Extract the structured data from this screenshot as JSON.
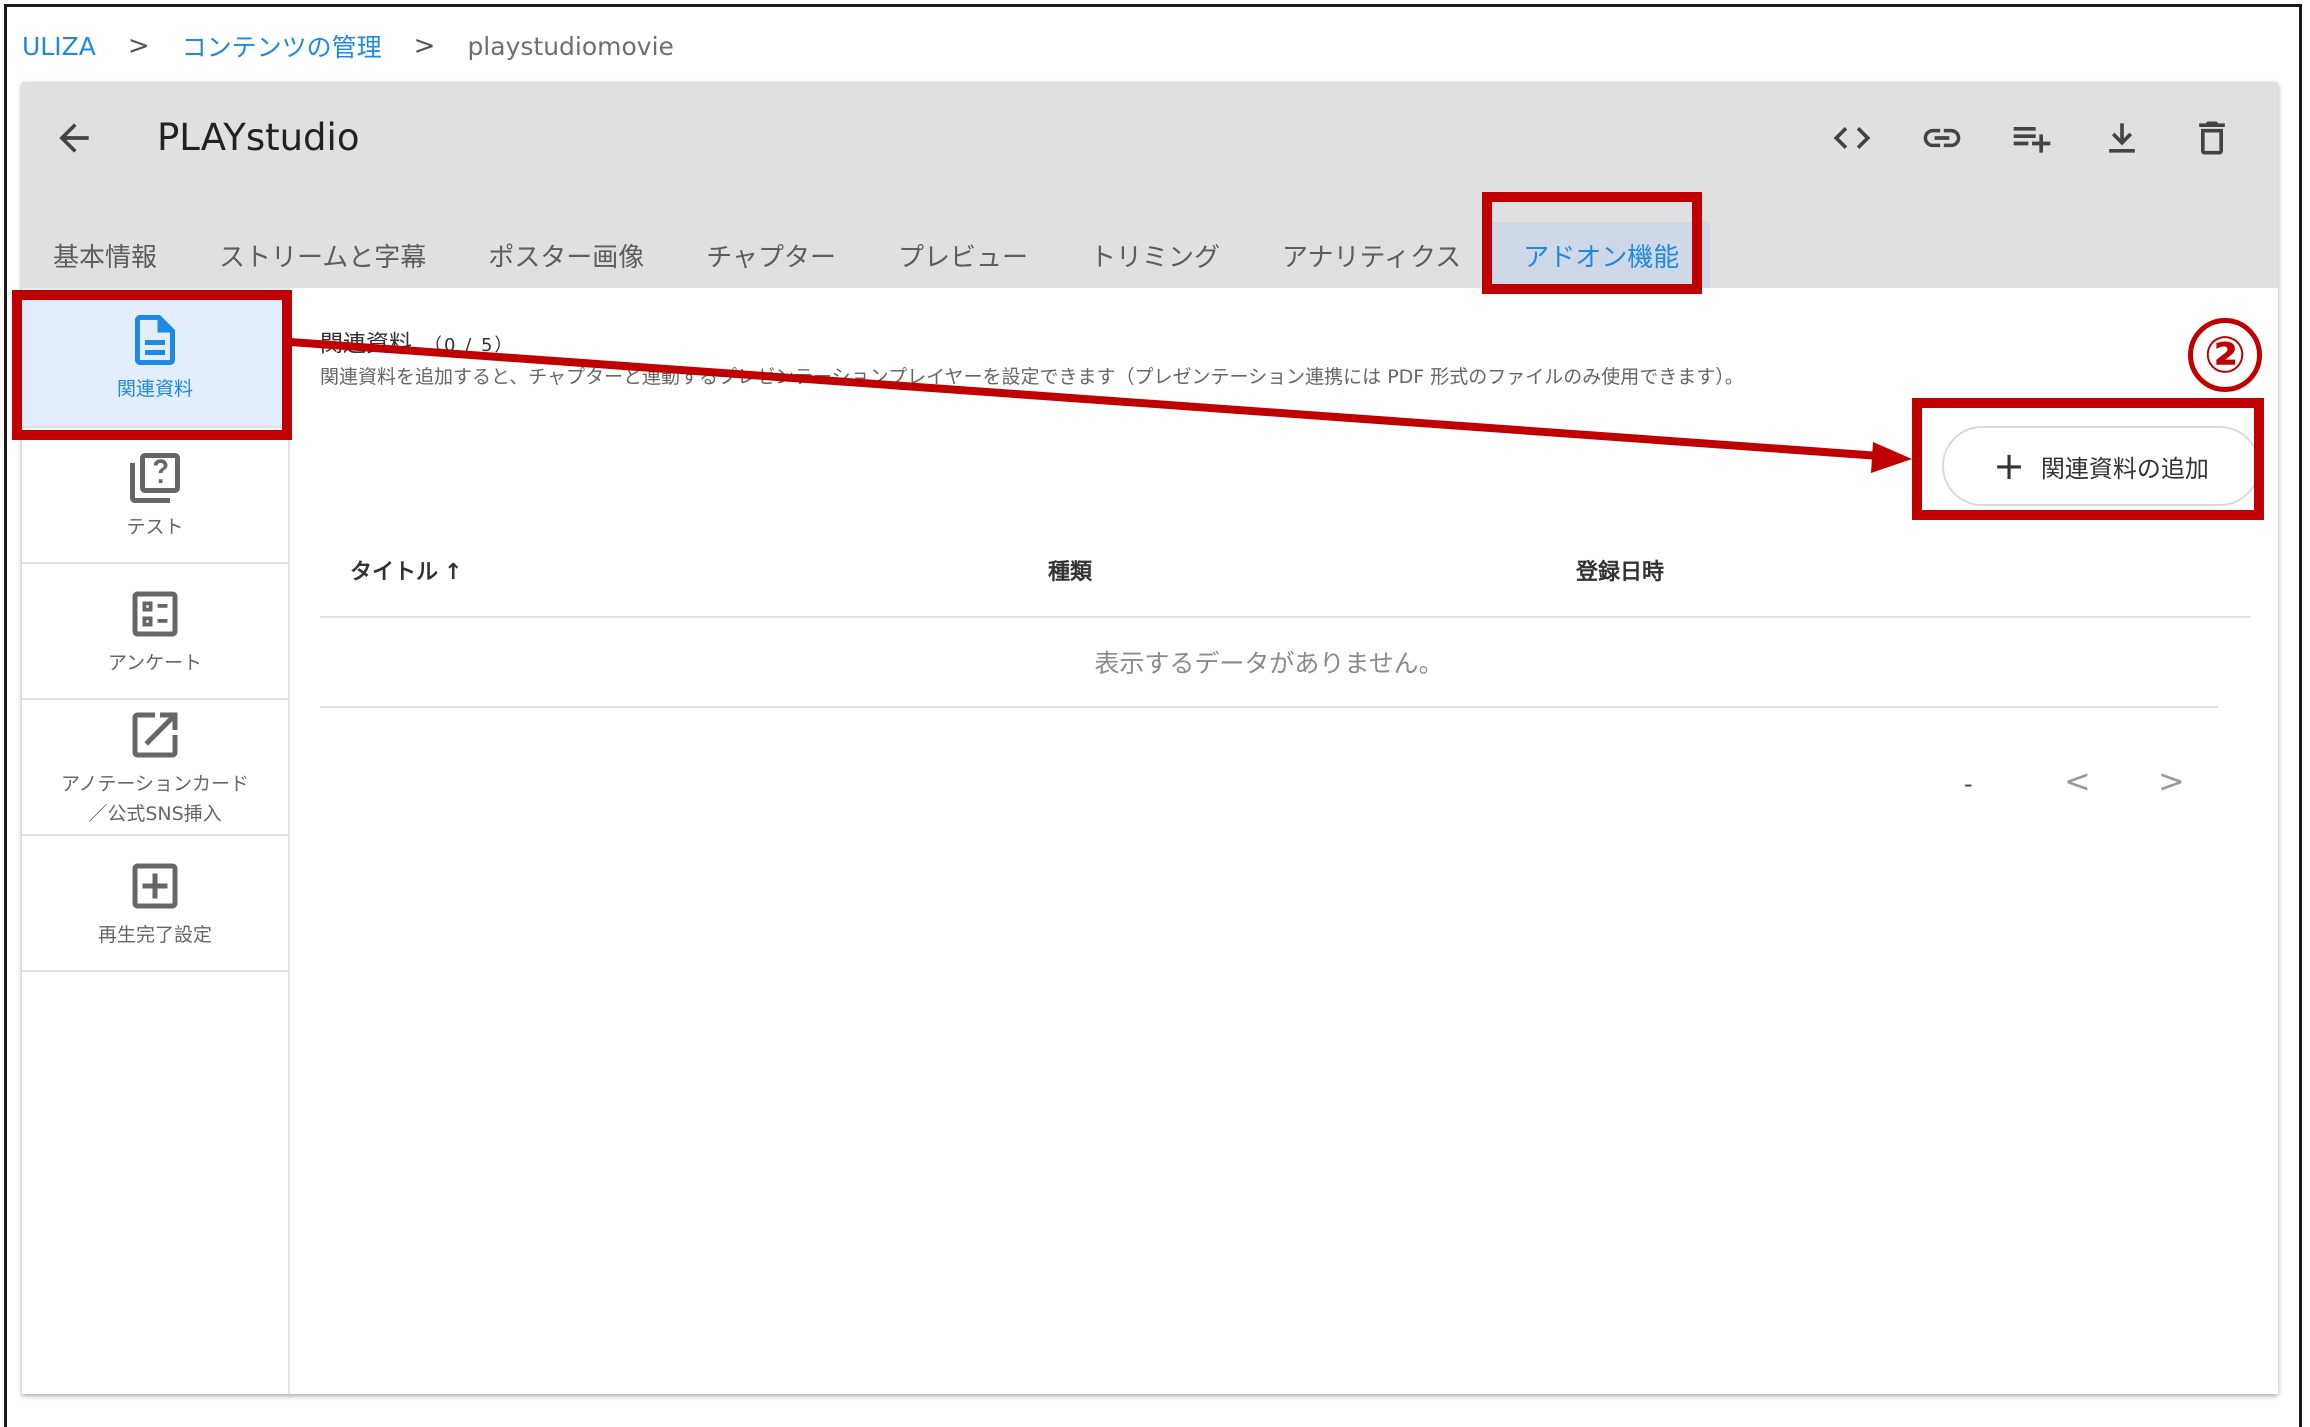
{
  "breadcrumb": {
    "items": [
      "ULIZA",
      "コンテンツの管理"
    ],
    "separator": ">",
    "current": "playstudiomovie"
  },
  "header": {
    "title": "PLAYstudio",
    "back_icon": "arrow-left-icon",
    "toolbar_icons": [
      "code-icon",
      "link-icon",
      "playlist-add-icon",
      "download-icon",
      "delete-icon"
    ]
  },
  "tabs": [
    {
      "label": "基本情報"
    },
    {
      "label": "ストリームと字幕"
    },
    {
      "label": "ポスター画像"
    },
    {
      "label": "チャプター"
    },
    {
      "label": "プレビュー"
    },
    {
      "label": "トリミング"
    },
    {
      "label": "アナリティクス"
    },
    {
      "label": "アドオン機能",
      "active": true
    }
  ],
  "sidebar": {
    "items": [
      {
        "label": "関連資料",
        "icon": "document-icon",
        "active": true
      },
      {
        "label": "テスト",
        "icon": "quiz-icon"
      },
      {
        "label": "アンケート",
        "icon": "survey-icon"
      },
      {
        "label": "アノテーションカード\n／公式SNS挿入",
        "icon": "open-external-icon"
      },
      {
        "label": "再生完了設定",
        "icon": "plus-box-icon"
      }
    ]
  },
  "main": {
    "section_title": "関連資料",
    "section_count": "（0 / 5）",
    "description": "関連資料を追加すると、チャプターと連動するプレゼンテーションプレイヤーを設定できます（プレゼンテーション連携には PDF 形式のファイルのみ使用できます）。",
    "add_button": {
      "plus": "+",
      "label": "関連資料の追加"
    },
    "table": {
      "columns": [
        "タイトル",
        "種類",
        "登録日時"
      ],
      "sort_indicator": "↑",
      "empty_message": "表示するデータがありません。"
    },
    "pagination": {
      "range": "-",
      "prev": "<",
      "next": ">"
    }
  },
  "annotation": {
    "step_number": "②",
    "highlight_color": "#c00000"
  },
  "colors": {
    "accent": "#1e88e5",
    "header_bg": "#e0e0e0",
    "active_tab_bg": "#cfd8e6",
    "active_sidebar_bg": "#e3eefc"
  }
}
